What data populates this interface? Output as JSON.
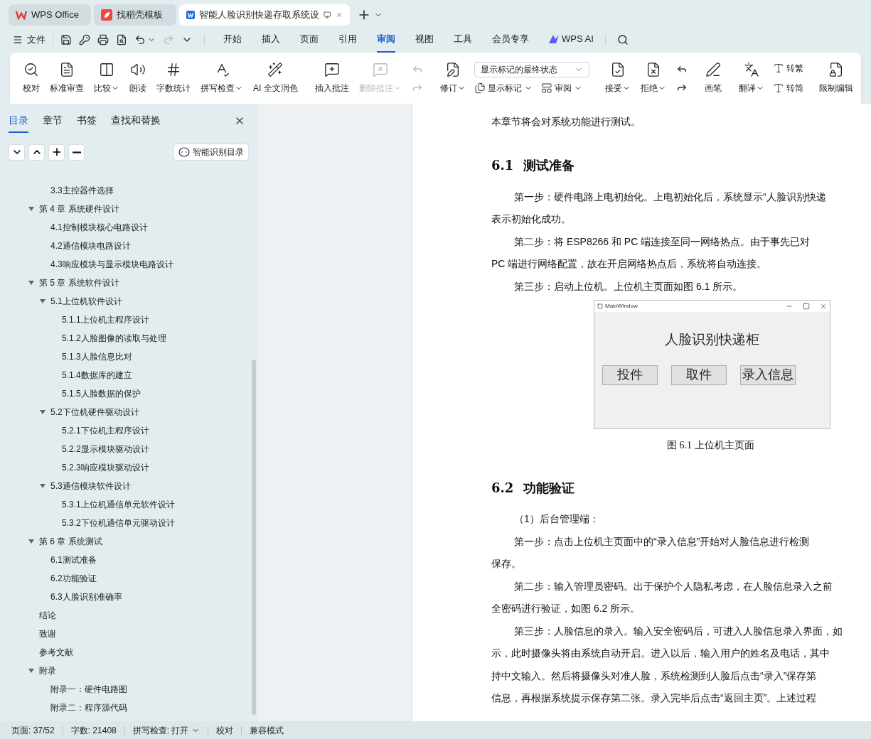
{
  "app_tabs": [
    {
      "label": "WPS Office",
      "selected": false
    },
    {
      "label": "找稻壳模板",
      "selected": false
    },
    {
      "label": "智能人脸识别快递存取系统设",
      "selected": true
    }
  ],
  "menu": {
    "file": "文件",
    "tabs": [
      {
        "label": "开始",
        "selected": false
      },
      {
        "label": "插入",
        "selected": false
      },
      {
        "label": "页面",
        "selected": false
      },
      {
        "label": "引用",
        "selected": false
      },
      {
        "label": "审阅",
        "selected": true
      },
      {
        "label": "视图",
        "selected": false
      },
      {
        "label": "工具",
        "selected": false
      },
      {
        "label": "会员专享",
        "selected": false
      },
      {
        "label": "WPS AI",
        "selected": false
      }
    ]
  },
  "ribbon": [
    [
      {
        "kind": "big",
        "label": "校对",
        "dropdown": false,
        "disabled": false
      },
      {
        "kind": "big",
        "label": "标准审查",
        "dropdown": false,
        "disabled": false
      },
      {
        "kind": "big",
        "label": "比较",
        "dropdown": true,
        "disabled": false
      },
      {
        "kind": "big",
        "label": "朗读",
        "dropdown": false,
        "disabled": false
      },
      {
        "kind": "big",
        "label": "字数统计",
        "dropdown": false,
        "disabled": false
      },
      {
        "kind": "big",
        "label": "拼写检查",
        "dropdown": true,
        "disabled": false
      },
      {
        "kind": "big",
        "label": "AI 全文润色",
        "dropdown": false,
        "disabled": false
      }
    ],
    [
      {
        "kind": "big",
        "label": "插入批注",
        "dropdown": false,
        "disabled": false
      },
      {
        "kind": "big",
        "label": "删除批注",
        "dropdown": true,
        "disabled": true
      },
      {
        "kind": "icon-pair",
        "disabled": true
      }
    ],
    [
      {
        "kind": "big",
        "label": "修订",
        "dropdown": true,
        "disabled": false
      },
      {
        "kind": "review-stack",
        "select": "显示标记的最终状态",
        "buttons": [
          {
            "label": "显示标记",
            "dropdown": true
          },
          {
            "label": "审阅",
            "dropdown": true
          }
        ]
      }
    ],
    [
      {
        "kind": "big",
        "label": "接受",
        "dropdown": true,
        "disabled": false
      },
      {
        "kind": "big",
        "label": "拒绝",
        "dropdown": true,
        "disabled": false
      },
      {
        "kind": "icon-pair",
        "disabled": false
      }
    ],
    [
      {
        "kind": "big",
        "label": "画笔",
        "dropdown": false,
        "disabled": false
      }
    ],
    [
      {
        "kind": "big",
        "label": "翻译",
        "dropdown": true,
        "disabled": false
      },
      {
        "kind": "small-stack",
        "buttons": [
          {
            "label": "转繁",
            "dropdown": false
          },
          {
            "label": "转简",
            "dropdown": false
          }
        ]
      }
    ],
    [
      {
        "kind": "big",
        "label": "限制编辑",
        "dropdown": false,
        "disabled": false
      }
    ]
  ],
  "nav": {
    "tabs": [
      {
        "label": "目录",
        "selected": true
      },
      {
        "label": "章节",
        "selected": false
      },
      {
        "label": "书签",
        "selected": false
      },
      {
        "label": "查找和替换",
        "selected": false
      }
    ],
    "smart_button": "智能识别目录",
    "toc": [
      {
        "children": [
          {
            "label": "3.3主控器件选择"
          }
        ]
      },
      {
        "label": "第 4 章 系统硬件设计",
        "expanded": true,
        "children": [
          {
            "label": "4.1控制模块核心电路设计"
          },
          {
            "label": "4.2通信模块电路设计"
          },
          {
            "label": "4.3响应模块与显示模块电路设计"
          }
        ]
      },
      {
        "label": "第 5 章 系统软件设计",
        "expanded": true,
        "children": [
          {
            "label": "5.1上位机软件设计",
            "expanded": true,
            "children": [
              {
                "label": "5.1.1上位机主程序设计"
              },
              {
                "label": "5.1.2人脸图像的读取与处理"
              },
              {
                "label": "5.1.3人脸信息比对"
              },
              {
                "label": "5.1.4数据库的建立"
              },
              {
                "label": "5.1.5人脸数据的保护"
              }
            ]
          },
          {
            "label": "5.2下位机硬件驱动设计",
            "expanded": true,
            "children": [
              {
                "label": "5.2.1下位机主程序设计"
              },
              {
                "label": "5.2.2显示模块驱动设计"
              },
              {
                "label": "5.2.3响应模块驱动设计"
              }
            ]
          },
          {
            "label": "5.3通信模块软件设计",
            "expanded": true,
            "children": [
              {
                "label": "5.3.1上位机通信单元软件设计"
              },
              {
                "label": "5.3.2下位机通信单元驱动设计"
              }
            ]
          }
        ]
      },
      {
        "label": "第 6 章 系统测试",
        "expanded": true,
        "children": [
          {
            "label": "6.1测试准备"
          },
          {
            "label": "6.2功能验证"
          },
          {
            "label": "6.3人脸识别准确率"
          }
        ]
      },
      {
        "label": "结论"
      },
      {
        "label": "致谢"
      },
      {
        "label": "参考文献"
      },
      {
        "label": "附录",
        "expanded": true,
        "children": [
          {
            "label": "附录一：硬件电路图"
          },
          {
            "label": "附录二：程序源代码"
          }
        ]
      }
    ]
  },
  "document": [
    {
      "kind": "paragraph",
      "indent": false,
      "lines": [
        "本章节将会对系统功能进行测试。"
      ]
    },
    {
      "kind": "heading",
      "number": "6.1",
      "title": "测试准备"
    },
    {
      "kind": "paragraph",
      "indent": true,
      "lines": [
        "第一步：硬件电路上电初始化。上电初始化后，系统显示“人脸识别快递",
        "表示初始化成功。"
      ]
    },
    {
      "kind": "paragraph",
      "indent": true,
      "lines": [
        "第二步：将 ESP8266 和 PC 端连接至同一网络热点。由于事先已对",
        "PC 端进行网络配置，故在开启网络热点后，系统将自动连接。"
      ]
    },
    {
      "kind": "paragraph",
      "indent": true,
      "lines": [
        "第三步：启动上位机。上位机主页面如图 6.1 所示。"
      ]
    },
    {
      "kind": "figure",
      "window_title": "MainWindow",
      "heading": "人脸识别快递柜",
      "buttons": [
        "投件",
        "取件",
        "录入信息"
      ]
    },
    {
      "kind": "caption",
      "text": "图 6.1 上位机主页面"
    },
    {
      "kind": "heading",
      "number": "6.2",
      "title": "功能验证"
    },
    {
      "kind": "paragraph",
      "indent": true,
      "lines": [
        "（1）后台管理端："
      ]
    },
    {
      "kind": "paragraph",
      "indent": true,
      "lines": [
        "第一步：点击上位机主页面中的“录入信息”开始对人脸信息进行检测",
        "保存。"
      ]
    },
    {
      "kind": "paragraph",
      "indent": true,
      "lines": [
        "第二步：输入管理员密码。出于保护个人隐私考虑，在人脸信息录入之前",
        "全密码进行验证，如图 6.2 所示。"
      ]
    },
    {
      "kind": "paragraph",
      "indent": true,
      "lines": [
        "第三步：人脸信息的录入。输入安全密码后，可进入人脸信息录入界面，如",
        "示，此时摄像头将由系统自动开启。进入以后，输入用户的姓名及电话，其中",
        "持中文输入。然后将摄像头对准人脸，系统检测到人脸后点击“录入”保存第",
        "信息，再根据系统提示保存第二张。录入完毕后点击“返回主页”。上述过程"
      ]
    }
  ],
  "status_bar": [
    {
      "text": "页面: 37/52",
      "dropdown": false
    },
    {
      "text": "字数: 21408",
      "dropdown": false
    },
    {
      "text": "拼写检查: 打开",
      "dropdown": true
    },
    {
      "text": "校对",
      "dropdown": false
    },
    {
      "text": "兼容模式",
      "dropdown": false
    }
  ]
}
